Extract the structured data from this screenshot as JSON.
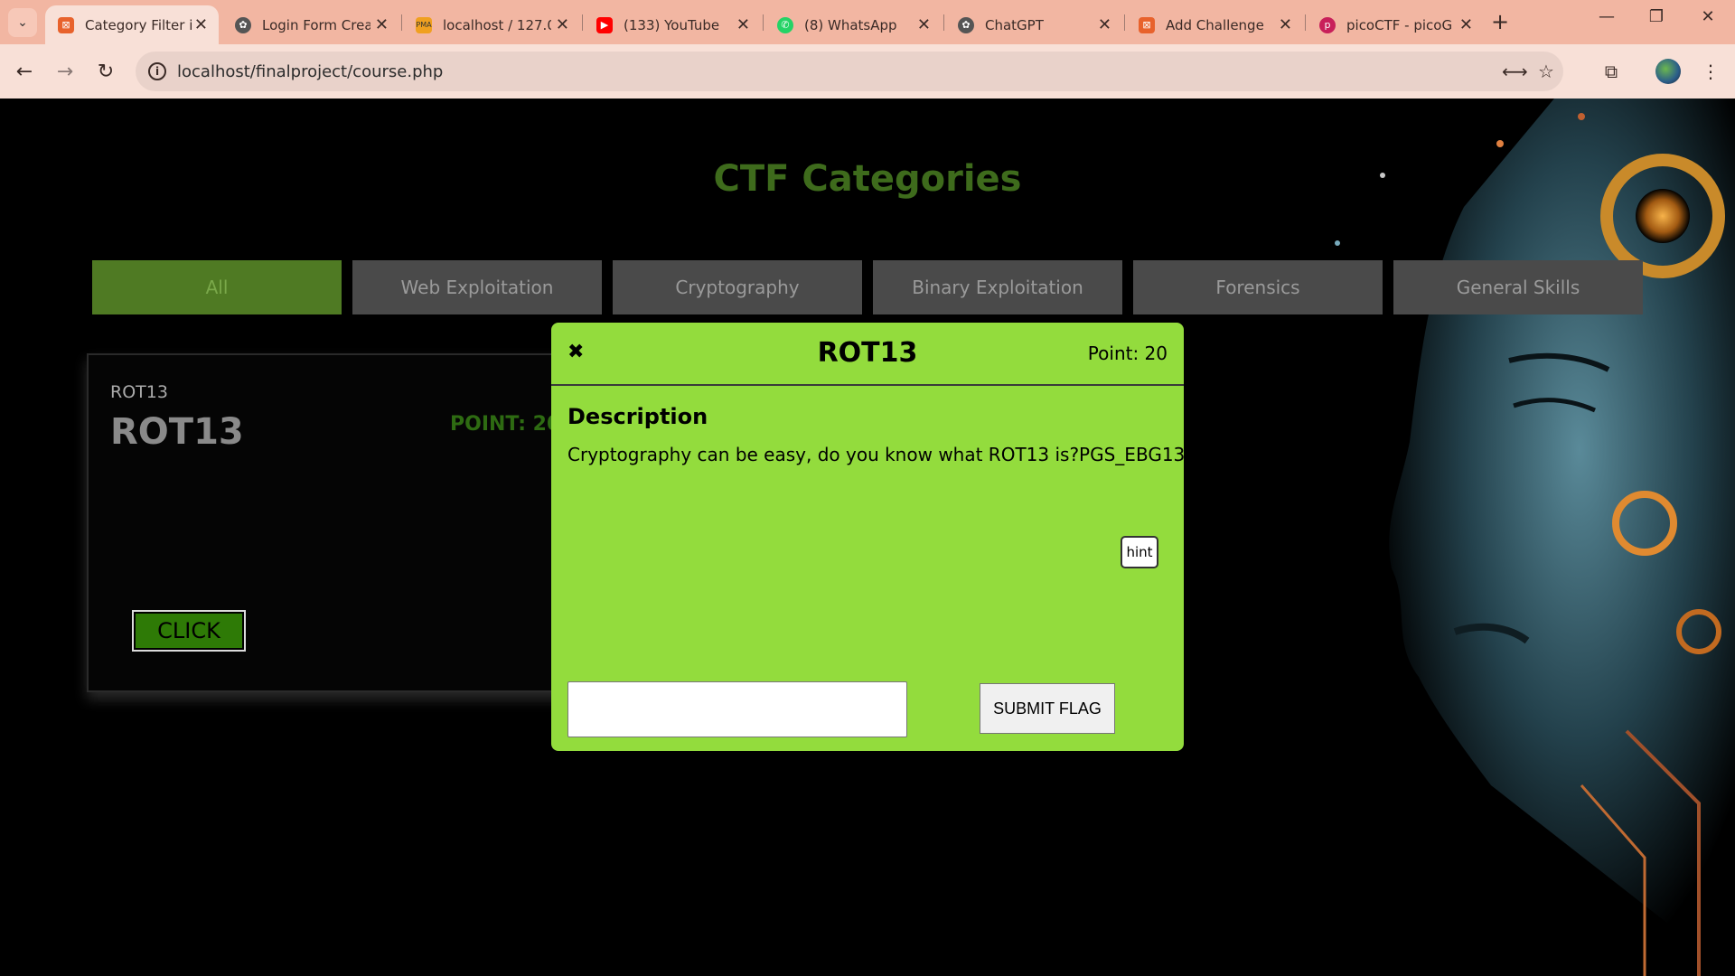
{
  "browser": {
    "tabs": [
      {
        "label": "Category Filter in",
        "icon": "xampp-icon",
        "active": true
      },
      {
        "label": "Login Form Crea",
        "icon": "chatgpt-icon",
        "active": false
      },
      {
        "label": "localhost / 127.0",
        "icon": "phpmyadmin-icon",
        "active": false
      },
      {
        "label": "(133) YouTube",
        "icon": "youtube-icon",
        "active": false
      },
      {
        "label": "(8) WhatsApp",
        "icon": "whatsapp-icon",
        "active": false
      },
      {
        "label": "ChatGPT",
        "icon": "chatgpt-icon",
        "active": false
      },
      {
        "label": "Add Challenge",
        "icon": "xampp-icon",
        "active": false
      },
      {
        "label": "picoCTF - picoG",
        "icon": "picoctf-icon",
        "active": false
      }
    ],
    "url": "localhost/finalproject/course.php"
  },
  "page": {
    "title": "CTF Categories",
    "categories": [
      "All",
      "Web Exploitation",
      "Cryptography",
      "Binary Exploitation",
      "Forensics",
      "General Skills"
    ],
    "active_category": "All"
  },
  "card": {
    "small_title": "ROT13",
    "title": "ROT13",
    "points": "POINT: 20",
    "button": "CLICK"
  },
  "modal": {
    "close": "✖",
    "title": "ROT13",
    "points": "Point: 20",
    "description_heading": "Description",
    "description": "Cryptography can be easy, do you know what ROT13 is?PGS_EBG13",
    "hint_label": "hint",
    "flag_value": "",
    "submit_label": "SUBMIT FLAG"
  },
  "colors": {
    "chrome_tabstrip": "#f2b6a2",
    "chrome_toolbar": "#f8e0d7",
    "title_green": "#3e6b1c",
    "active_category": "#4f7a23",
    "modal_bg": "#93dc3d"
  }
}
